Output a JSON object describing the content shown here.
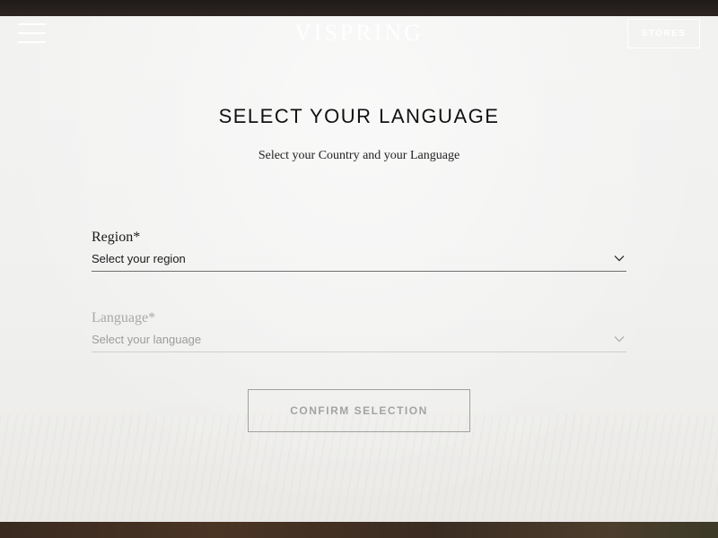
{
  "header": {
    "logo": "VISPRING",
    "stores_label": "STORES"
  },
  "modal": {
    "title": "SELECT YOUR LANGUAGE",
    "subtitle": "Select your Country and your Language",
    "region": {
      "label": "Region*",
      "placeholder": "Select your region"
    },
    "language": {
      "label": "Language*",
      "placeholder": "Select your language",
      "enabled": false
    },
    "confirm_label": "CONFIRM SELECTION"
  },
  "icons": {
    "menu": "hamburger-menu-icon",
    "select_arrow": "chevron-down-icon"
  },
  "colors": {
    "overlay_background": "#f1f1f0",
    "text_primary": "#111111",
    "disabled_text": "#a3a3a3"
  }
}
